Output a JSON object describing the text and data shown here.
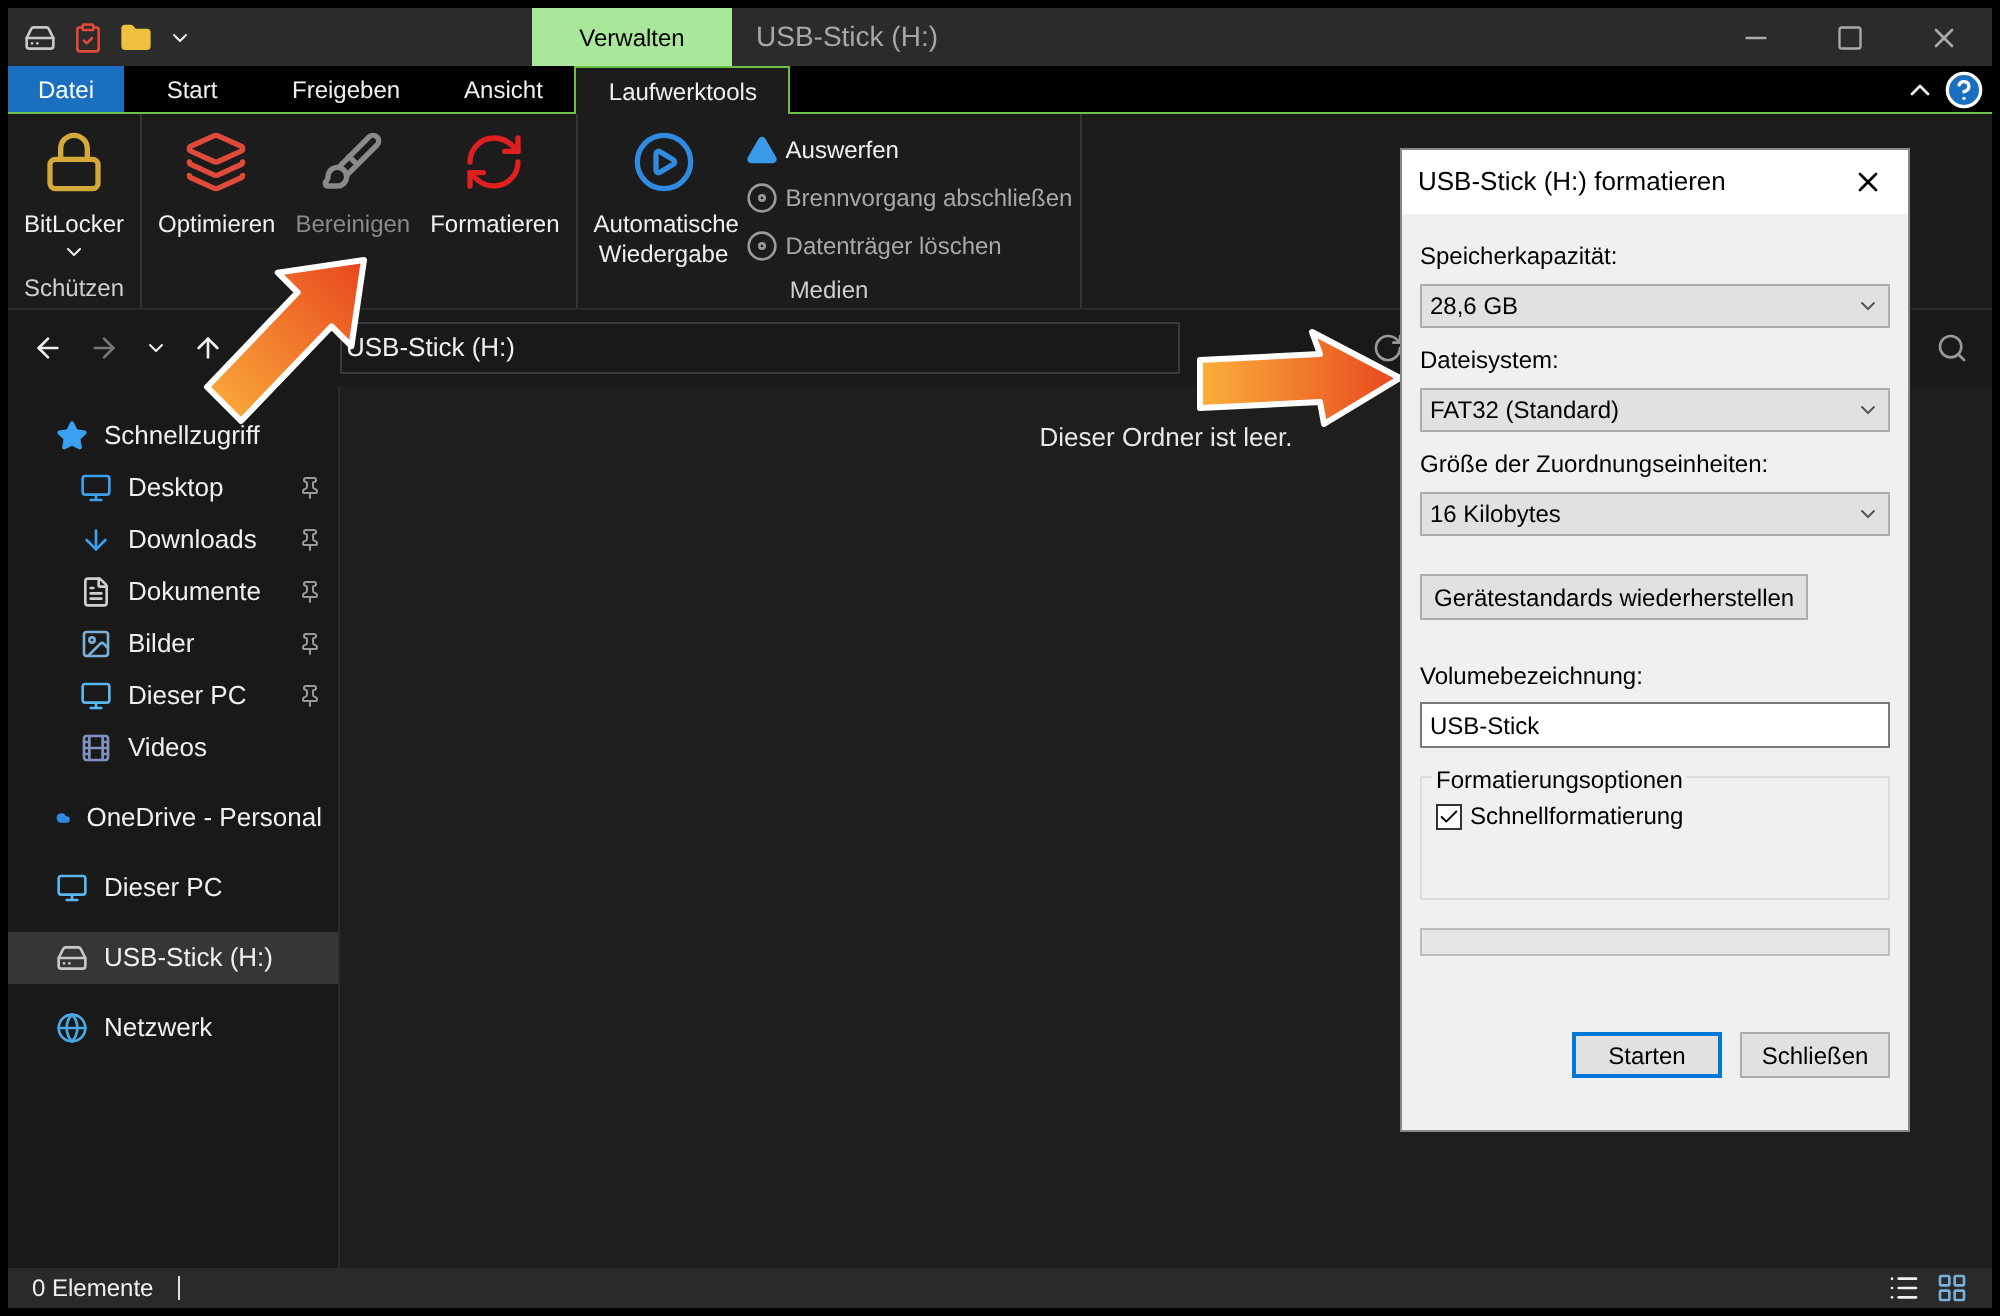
{
  "title_bar": {
    "context_tab": "Verwalten",
    "title": "USB-Stick (H:)"
  },
  "ribbon_tabs": [
    {
      "label": "Datei",
      "kind": "file",
      "selected": false
    },
    {
      "label": "Start",
      "kind": "normal",
      "selected": false
    },
    {
      "label": "Freigeben",
      "kind": "normal",
      "selected": false
    },
    {
      "label": "Ansicht",
      "kind": "normal",
      "selected": false
    },
    {
      "label": "Laufwerktools",
      "kind": "normal",
      "selected": true
    }
  ],
  "ribbon_groups": [
    {
      "label": "Schützen",
      "items": [
        {
          "label": "BitLocker",
          "kind": "large",
          "dropdown": true,
          "disabled": false
        }
      ]
    },
    {
      "items": [
        {
          "label": "Optimieren",
          "kind": "large",
          "disabled": false
        },
        {
          "label": "Bereinigen",
          "kind": "large",
          "disabled": true
        },
        {
          "label": "Formatieren",
          "kind": "large",
          "disabled": false
        }
      ]
    },
    {
      "label": "Medien",
      "items": [
        {
          "label": "Automatische Wiedergabe",
          "kind": "large",
          "disabled": false
        },
        {
          "label": "Auswerfen",
          "kind": "small",
          "disabled": false
        },
        {
          "label": "Brennvorgang abschließen",
          "kind": "small",
          "disabled": true
        },
        {
          "label": "Datenträger löschen",
          "kind": "small",
          "disabled": true
        }
      ]
    }
  ],
  "address_bar": {
    "path": "USB-Stick (H:)"
  },
  "navigation": [
    {
      "label": "Schnellzugriff",
      "selected": false,
      "pinned": false,
      "children": [
        {
          "label": "Desktop",
          "selected": false,
          "pinned": true
        },
        {
          "label": "Downloads",
          "selected": false,
          "pinned": true
        },
        {
          "label": "Dokumente",
          "selected": false,
          "pinned": true
        },
        {
          "label": "Bilder",
          "selected": false,
          "pinned": true
        },
        {
          "label": "Dieser PC",
          "selected": false,
          "pinned": true
        },
        {
          "label": "Videos",
          "selected": false,
          "pinned": false
        }
      ]
    },
    {
      "label": "OneDrive - Personal",
      "selected": false,
      "pinned": false
    },
    {
      "label": "Dieser PC",
      "selected": false,
      "pinned": false
    },
    {
      "label": "USB-Stick (H:)",
      "selected": true,
      "pinned": false
    },
    {
      "label": "Netzwerk",
      "selected": false,
      "pinned": false
    }
  ],
  "empty_message": "Dieser Ordner ist leer.",
  "status_bar": {
    "count": "0 Elemente"
  },
  "dialog": {
    "title": "USB-Stick (H:) formatieren",
    "fields": [
      {
        "label": "Speicherkapazität:",
        "value": "28,6 GB",
        "kind": "select"
      },
      {
        "label": "Dateisystem:",
        "value": "FAT32 (Standard)",
        "kind": "select"
      },
      {
        "label": "Größe der Zuordnungseinheiten:",
        "value": "16 Kilobytes",
        "kind": "select"
      }
    ],
    "restore_button": "Gerätestandards wiederherstellen",
    "volume": {
      "label": "Volumebezeichnung:",
      "value": "USB-Stick"
    },
    "options": {
      "title": "Formatierungsoptionen",
      "items": [
        {
          "label": "Schnellformatierung",
          "checked": true
        }
      ]
    },
    "progress": {
      "level": 0
    },
    "buttons": [
      {
        "label": "Starten",
        "default": true
      },
      {
        "label": "Schließen",
        "default": false
      }
    ]
  }
}
